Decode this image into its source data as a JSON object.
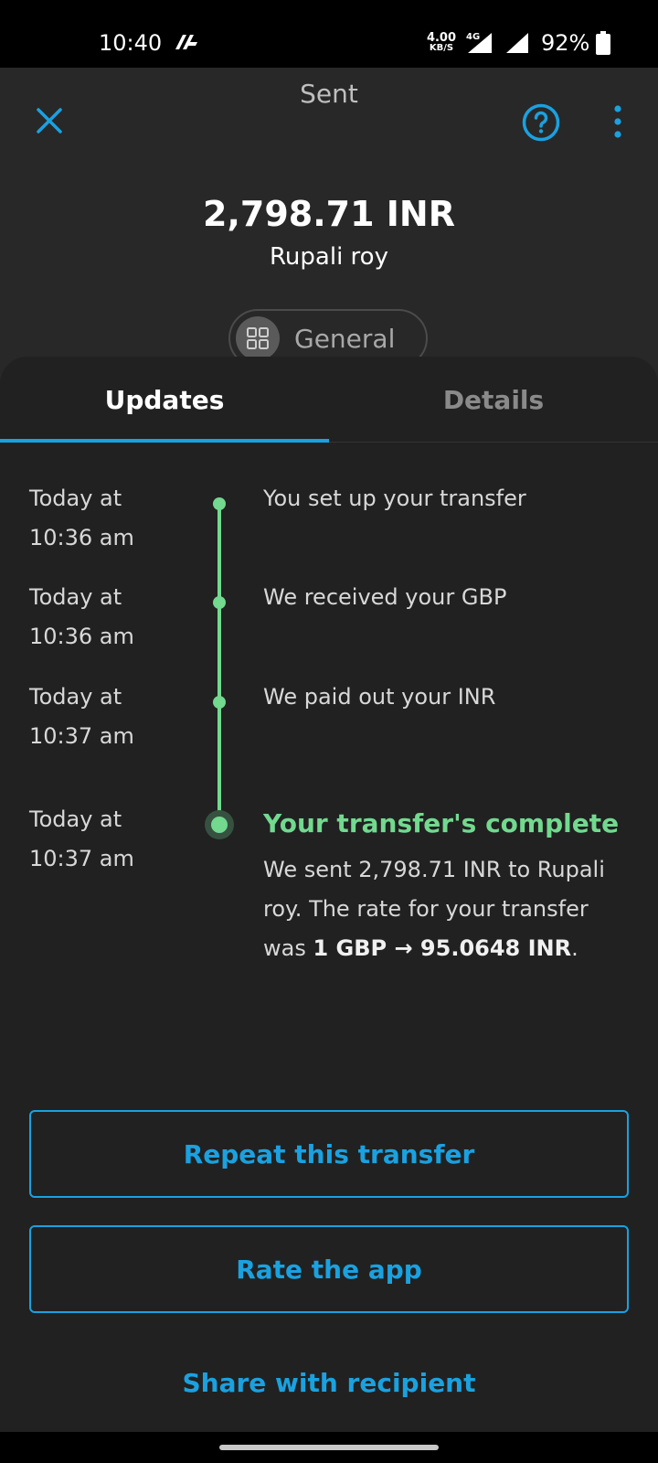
{
  "status_bar": {
    "time": "10:40",
    "speed_value": "4.00",
    "speed_unit": "KB/S",
    "network": "4G",
    "battery": "92%"
  },
  "header": {
    "title": "Sent"
  },
  "transfer": {
    "amount": "2,798.71 INR",
    "recipient": "Rupali roy",
    "category": "General"
  },
  "tabs": [
    {
      "label": "Updates",
      "active": true
    },
    {
      "label": "Details",
      "active": false
    }
  ],
  "timeline": [
    {
      "time_line1": "Today at",
      "time_line2": "10:36 am",
      "text": "You set up your transfer"
    },
    {
      "time_line1": "Today at",
      "time_line2": "10:36 am",
      "text": "We received your GBP"
    },
    {
      "time_line1": "Today at",
      "time_line2": "10:37 am",
      "text": "We paid out your INR"
    },
    {
      "time_line1": "Today at",
      "time_line2": "10:37 am",
      "title": "Your transfer's complete",
      "desc_prefix": "We sent 2,798.71 INR to Rupali roy. The rate for your transfer was ",
      "rate": "1 GBP → 95.0648 INR",
      "desc_suffix": "."
    }
  ],
  "actions": {
    "repeat": "Repeat this transfer",
    "rate_app": "Rate the app",
    "share": "Share with recipient"
  },
  "colors": {
    "accent": "#1aa1e0",
    "success": "#72d98f",
    "background": "#212121"
  }
}
